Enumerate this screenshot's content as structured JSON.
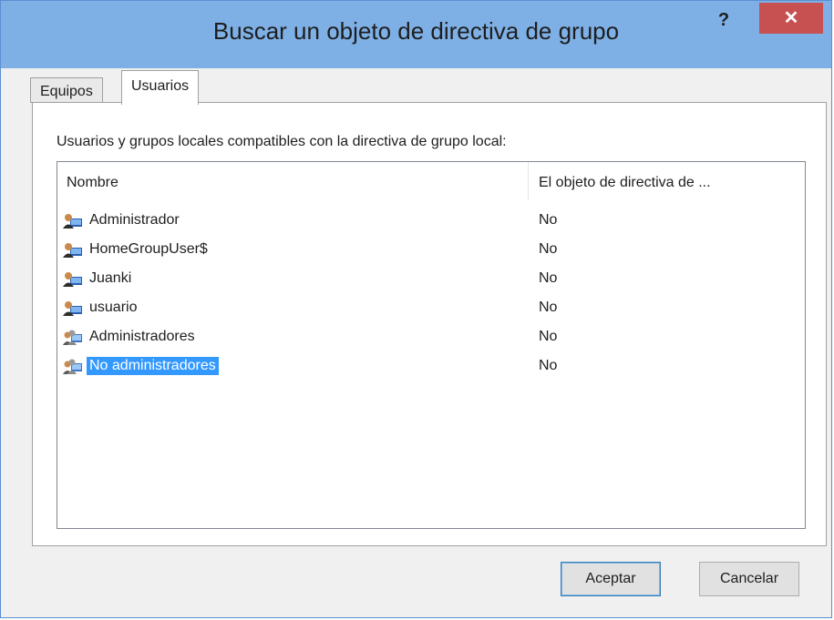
{
  "window": {
    "title": "Buscar un objeto de directiva de grupo",
    "help_label": "?",
    "close_label": "✕"
  },
  "tabs": [
    {
      "label": "Equipos",
      "active": false
    },
    {
      "label": "Usuarios",
      "active": true
    }
  ],
  "panel": {
    "label": "Usuarios y grupos locales compatibles con la directiva de grupo local:"
  },
  "list": {
    "columns": [
      "Nombre",
      "El objeto de directiva de ..."
    ],
    "rows": [
      {
        "name": "Administrador",
        "value": "No",
        "icon": "user-icon",
        "selected": false
      },
      {
        "name": "HomeGroupUser$",
        "value": "No",
        "icon": "user-icon",
        "selected": false
      },
      {
        "name": "Juanki",
        "value": "No",
        "icon": "user-icon",
        "selected": false
      },
      {
        "name": "usuario",
        "value": "No",
        "icon": "user-icon",
        "selected": false
      },
      {
        "name": "Administradores",
        "value": "No",
        "icon": "group-icon",
        "selected": false
      },
      {
        "name": "No administradores",
        "value": "No",
        "icon": "group-icon",
        "selected": true
      }
    ]
  },
  "buttons": {
    "ok": "Aceptar",
    "cancel": "Cancelar"
  },
  "colors": {
    "titlebar": "#7eb0e6",
    "close": "#c75050",
    "selection": "#3399ff"
  }
}
